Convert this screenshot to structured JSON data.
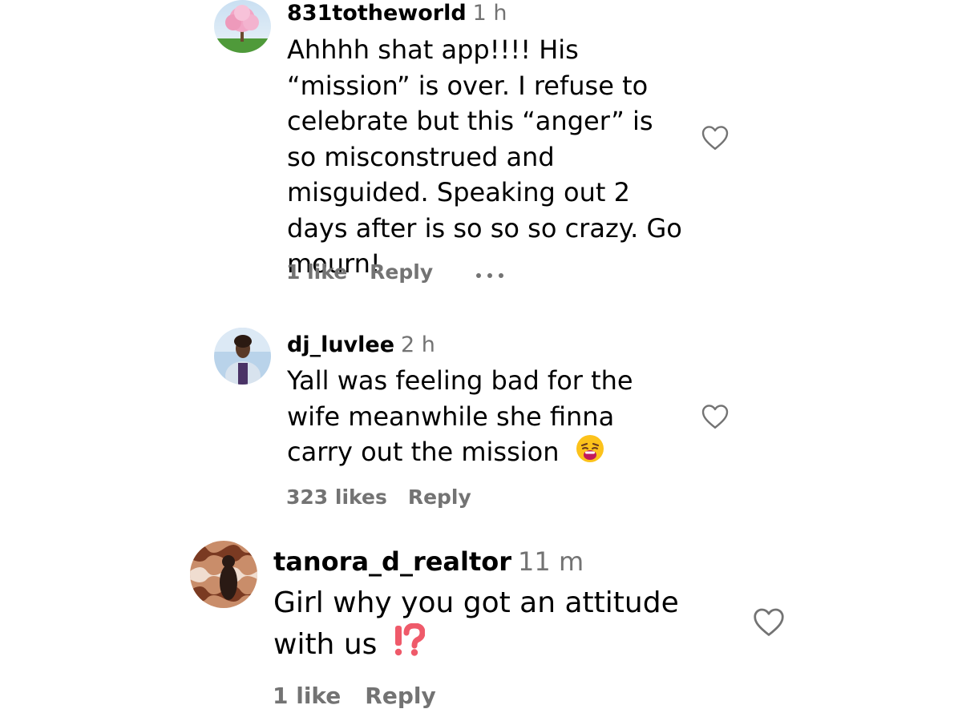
{
  "comments": [
    {
      "username": "831totheworld",
      "time": "1 h",
      "text": "Ahhhh shat app!!!! His “mission” is over. I refuse to celebrate but this “anger” is so misconstrued and misguided. Speaking out 2 days after is so so so crazy. Go mourn!",
      "likes": "1 like",
      "reply_label": "Reply",
      "more_icon": "more-options-icon",
      "like_icon": "heart-outline-icon"
    },
    {
      "username": "dj_luvlee",
      "time": "2 h",
      "text": "Yall was feeling bad for the wife meanwhile she finna carry out the mission",
      "emoji": "weary-face-emoji",
      "likes": "323 likes",
      "reply_label": "Reply",
      "like_icon": "heart-outline-icon"
    },
    {
      "username": "tanora_d_realtor",
      "time": "11 m",
      "text": "Girl why you got an attitude with us",
      "emoji": "exclamation-question-mark-emoji",
      "likes": "1 like",
      "reply_label": "Reply",
      "like_icon": "heart-outline-icon"
    }
  ],
  "colors": {
    "text": "#000000",
    "muted": "#737373",
    "background": "#ffffff"
  }
}
